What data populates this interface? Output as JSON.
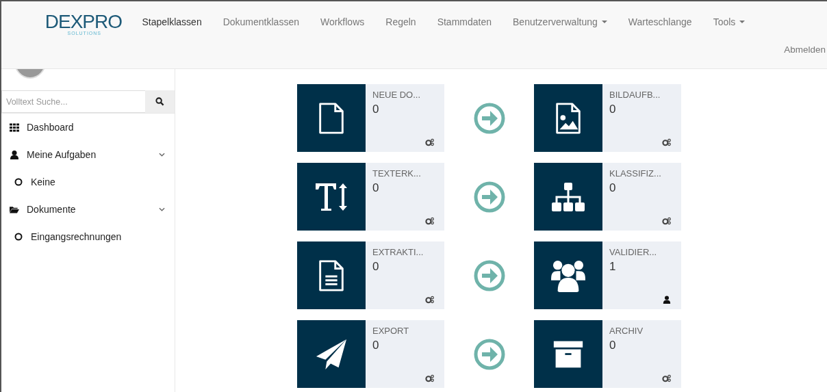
{
  "logo": {
    "name": "DEXPRO",
    "tagline": "SOLUTIONS"
  },
  "nav": [
    {
      "label": "Stapelklassen",
      "selected": true,
      "dropdown": false
    },
    {
      "label": "Dokumentklassen",
      "selected": false,
      "dropdown": false
    },
    {
      "label": "Workflows",
      "selected": false,
      "dropdown": false
    },
    {
      "label": "Regeln",
      "selected": false,
      "dropdown": false
    },
    {
      "label": "Stammdaten",
      "selected": false,
      "dropdown": false
    },
    {
      "label": "Benutzerverwaltung",
      "selected": false,
      "dropdown": true
    },
    {
      "label": "Warteschlange",
      "selected": false,
      "dropdown": false
    },
    {
      "label": "Tools",
      "selected": false,
      "dropdown": true
    }
  ],
  "logout": "Abmelden",
  "sidebar": {
    "search": {
      "placeholder": "Volltext Suche..."
    },
    "items": [
      {
        "kind": "link",
        "label": "Dashboard"
      },
      {
        "kind": "group",
        "label": "Meine Aufgaben",
        "expanded": true,
        "children": [
          {
            "label": "Keine"
          }
        ]
      },
      {
        "kind": "group",
        "label": "Dokumente",
        "expanded": true,
        "children": [
          {
            "label": "Eingangsrechnungen"
          }
        ]
      }
    ]
  },
  "workflow": [
    [
      {
        "title": "NEUE DO...",
        "count": "0"
      },
      {
        "title": "BILDAUFB...",
        "count": "0"
      }
    ],
    [
      {
        "title": "TEXTERK...",
        "count": "0"
      },
      {
        "title": "KLASSIFIZ...",
        "count": "0"
      }
    ],
    [
      {
        "title": "EXTRAKTI...",
        "count": "0"
      },
      {
        "title": "VALIDIER...",
        "count": "1"
      }
    ],
    [
      {
        "title": "EXPORT",
        "count": "0"
      },
      {
        "title": "ARCHIV",
        "count": "0"
      }
    ]
  ]
}
